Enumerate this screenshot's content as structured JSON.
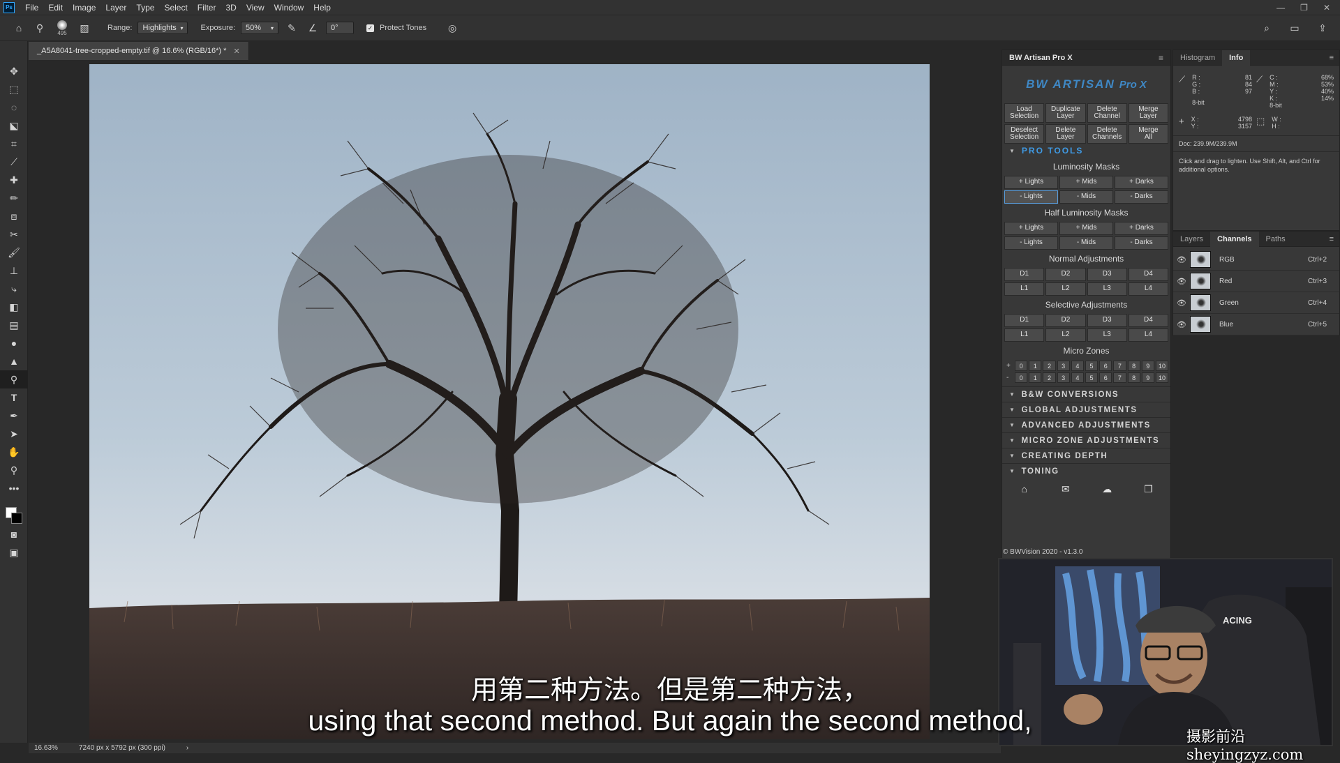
{
  "menubar": {
    "items": [
      "File",
      "Edit",
      "Image",
      "Layer",
      "Type",
      "Select",
      "Filter",
      "3D",
      "View",
      "Window",
      "Help"
    ]
  },
  "options": {
    "brush_size": "495",
    "range_label": "Range:",
    "range_value": "Highlights",
    "exposure_label": "Exposure:",
    "exposure_value": "50%",
    "angle_value": "0°",
    "protect_tones": "Protect Tones"
  },
  "document": {
    "tab_title": "_A5A8041-tree-cropped-empty.tif @ 16.6% (RGB/16*) *",
    "zoom": "16.63%",
    "dims": "7240 px x 5792 px (300 ppi)"
  },
  "artisan": {
    "title": "BW Artisan Pro X",
    "logo_text": "BW ARTISAN",
    "logo_version": "Pro X",
    "top_buttons": [
      [
        "Load",
        "Selection"
      ],
      [
        "Duplicate",
        "Layer"
      ],
      [
        "Delete",
        "Channel"
      ],
      [
        "Merge",
        "Layer"
      ],
      [
        "Deselect",
        "Selection"
      ],
      [
        "Delete",
        "Layer"
      ],
      [
        "Delete",
        "Channels"
      ],
      [
        "Merge",
        "All"
      ]
    ],
    "pro_tools": "PRO TOOLS",
    "lum_title": "Luminosity Masks",
    "lum_buttons": [
      "+ Lights",
      "+ Mids",
      "+ Darks",
      "- Lights",
      "- Mids",
      "- Darks"
    ],
    "half_title": "Half Luminosity Masks",
    "half_buttons": [
      "+ Lights",
      "+ Mids",
      "+ Darks",
      "- Lights",
      "- Mids",
      "- Darks"
    ],
    "normal_title": "Normal Adjustments",
    "normal_buttons": [
      "D1",
      "D2",
      "D3",
      "D4",
      "L1",
      "L2",
      "L3",
      "L4"
    ],
    "selective_title": "Selective Adjustments",
    "selective_buttons": [
      "D1",
      "D2",
      "D3",
      "D4",
      "L1",
      "L2",
      "L3",
      "L4"
    ],
    "micro_title": "Micro Zones",
    "micro_plus": "+",
    "micro_minus": "-",
    "micro_values": [
      "0",
      "1",
      "2",
      "3",
      "4",
      "5",
      "6",
      "7",
      "8",
      "9",
      "10"
    ],
    "sections": [
      "B&W CONVERSIONS",
      "GLOBAL ADJUSTMENTS",
      "ADVANCED ADJUSTMENTS",
      "MICRO ZONE ADJUSTMENTS",
      "CREATING DEPTH",
      "TONING"
    ],
    "credit": "© BWVision 2020 - v1.3.0"
  },
  "info": {
    "tab_histogram": "Histogram",
    "tab_info": "Info",
    "r": "81",
    "g": "84",
    "b": "97",
    "c": "68%",
    "m": "53%",
    "y": "40%",
    "k": "14%",
    "bit_left": "8-bit",
    "bit_right": "8-bit",
    "x": "4798",
    "y_coord": "3157",
    "doc": "Doc: 239.9M/239.9M",
    "hint": "Click and drag to lighten. Use Shift, Alt, and Ctrl for additional options."
  },
  "channels": {
    "tab_layers": "Layers",
    "tab_channels": "Channels",
    "tab_paths": "Paths",
    "rows": [
      {
        "name": "RGB",
        "shortcut": "Ctrl+2"
      },
      {
        "name": "Red",
        "shortcut": "Ctrl+3"
      },
      {
        "name": "Green",
        "shortcut": "Ctrl+4"
      },
      {
        "name": "Blue",
        "shortcut": "Ctrl+5"
      }
    ]
  },
  "subtitles": {
    "zh": "用第二种方法。但是第二种方法，",
    "en": "using that second method. But again the second method,"
  },
  "watermark": "摄影前沿 sheyingzyz.com",
  "webcam": {
    "chair_text": "ACING"
  }
}
